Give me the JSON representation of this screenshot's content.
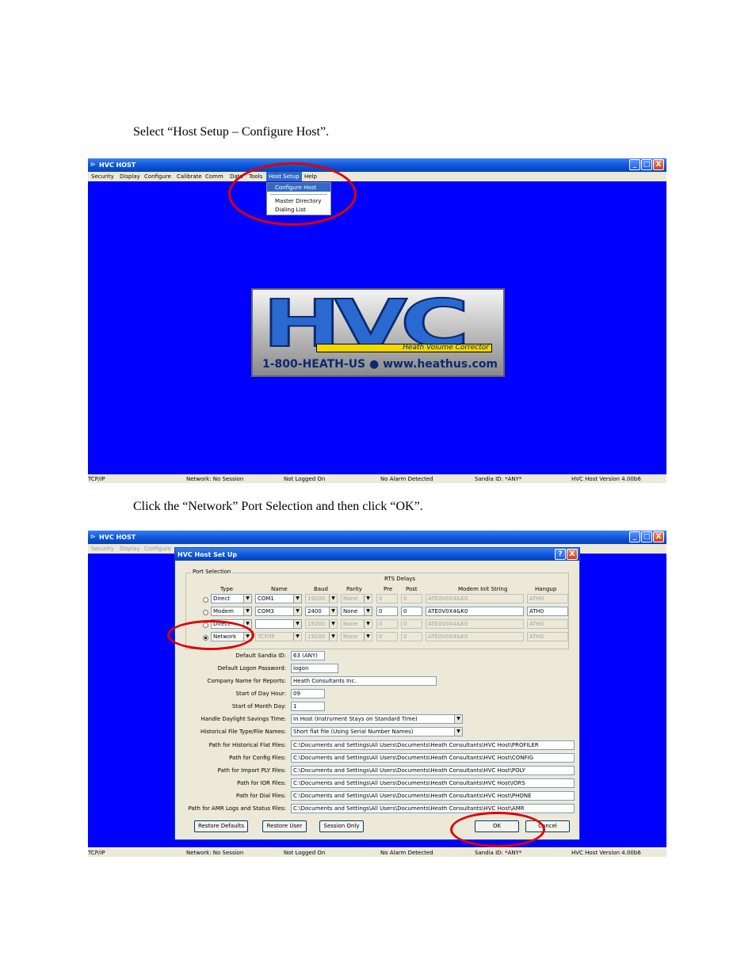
{
  "captions": {
    "step1": "Select “Host Setup – Configure Host”.",
    "step2": "Click the “Network” Port Selection and then click “OK”."
  },
  "window": {
    "title": "HVC HOST",
    "minimize": "_",
    "restore": "□",
    "close": "X"
  },
  "menu": [
    "Security",
    "Display",
    "Configure",
    "Calibrate",
    "Comm",
    "Data",
    "Tools",
    "Host Setup",
    "Help"
  ],
  "host_setup_menu": {
    "items": [
      "Configure Host",
      "Master Directory",
      "Dialing List"
    ]
  },
  "logo": {
    "letters": "HVC",
    "tagline": "Heath Volume Corrector",
    "phone": "1-800-HEATH-US ● www.heathus.com"
  },
  "status": {
    "protocol": "TCP/IP",
    "network": "Network: No Session",
    "login": "Not Logged On",
    "alarm": "No Alarm Detected",
    "sandia": "Sandia ID: *ANY*",
    "version": "HVC Host Version 4.00b6"
  },
  "dialog": {
    "title": "HVC Host Set Up",
    "help": "?",
    "close": "X",
    "port_group": "Port Selection",
    "rts_delays": "RTS Delays",
    "headers": {
      "type": "Type",
      "name": "Name",
      "baud": "Baud",
      "parity": "Parity",
      "pre": "Pre",
      "post": "Post",
      "modem_init": "Modem Init String",
      "hangup": "Hangup"
    },
    "ports": [
      {
        "type": "Direct",
        "name": "COM1",
        "baud": "19200",
        "parity": "None",
        "pre": "0",
        "post": "0",
        "init": "ATE0V0X4&K0",
        "hangup": "ATH0",
        "enabled": false,
        "selected": false
      },
      {
        "type": "Modem",
        "name": "COM3",
        "baud": "2400",
        "parity": "None",
        "pre": "0",
        "post": "0",
        "init": "ATE0V0X4&K0",
        "hangup": "ATH0",
        "enabled": true,
        "selected": false
      },
      {
        "type": "Direct",
        "name": "",
        "baud": "19200",
        "parity": "None",
        "pre": "0",
        "post": "0",
        "init": "ATE0V0X4&K0",
        "hangup": "ATH0",
        "enabled": false,
        "selected": false
      },
      {
        "type": "Network",
        "name": "TCP/IP",
        "baud": "19200",
        "parity": "None",
        "pre": "0",
        "post": "0",
        "init": "ATE0V0X4&K0",
        "hangup": "ATH0",
        "enabled": false,
        "selected": true
      }
    ],
    "fields": [
      {
        "label": "Default Sandia ID:",
        "value": "63 (ANY)"
      },
      {
        "label": "Default Logon Password:",
        "value": "logon"
      },
      {
        "label": "Company Name for Reports:",
        "value": "Heath Consultants Inc."
      },
      {
        "label": "Start of Day Hour:",
        "value": "09"
      },
      {
        "label": "Start of Month Day:",
        "value": "1"
      },
      {
        "label": "Handle Daylight Savings Time:",
        "value": "In Host (Instrument Stays on Standard Time)"
      },
      {
        "label": "Historical File Type/File Names:",
        "value": "Short flat file (Using Serial Number Names)"
      },
      {
        "label": "Path for Historical Flat Files:",
        "value": "C:\\Documents and Settings\\All Users\\Documents\\Heath Consultants\\HVC Host\\PROFILER"
      },
      {
        "label": "Path for Config Files:",
        "value": "C:\\Documents and Settings\\All Users\\Documents\\Heath Consultants\\HVC Host\\CONFIG"
      },
      {
        "label": "Path for Import PLY Files:",
        "value": "C:\\Documents and Settings\\All Users\\Documents\\Heath Consultants\\HVC Host\\POLY"
      },
      {
        "label": "Path for IOR Files:",
        "value": "C:\\Documents and Settings\\All Users\\Documents\\Heath Consultants\\HVC Host\\IORS"
      },
      {
        "label": "Path for Dial Files:",
        "value": "C:\\Documents and Settings\\All Users\\Documents\\Heath Consultants\\HVC Host\\PHONE"
      },
      {
        "label": "Path for AMR Logs and Status Files:",
        "value": "C:\\Documents and Settings\\All Users\\Documents\\Heath Consultants\\HVC Host\\AMR"
      }
    ],
    "buttons": {
      "restore_defaults": "Restore Defaults",
      "restore_user": "Restore User",
      "session_only": "Session Only",
      "ok": "OK",
      "cancel": "Cancel"
    }
  },
  "colors": {
    "desktop": "#0000ff",
    "highlight": "#e00000"
  }
}
